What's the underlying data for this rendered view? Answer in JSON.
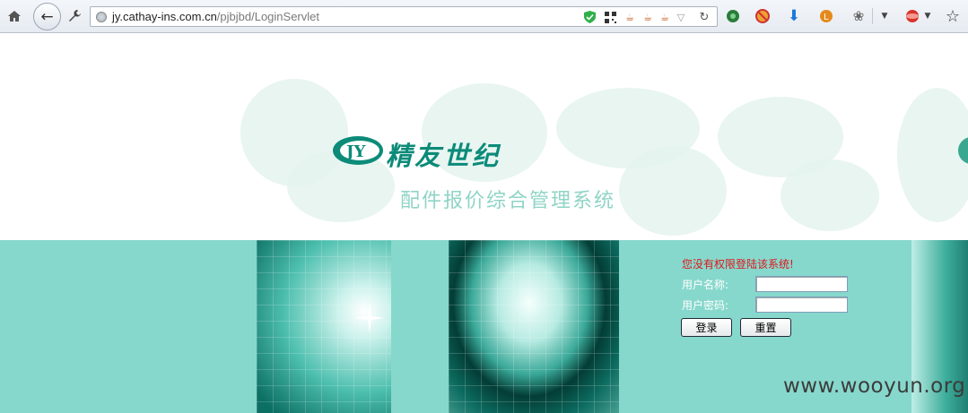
{
  "browser": {
    "url_host": "jy.cathay-ins.com.cn",
    "url_path": "/pjbjbd/LoginServlet"
  },
  "banner": {
    "logo_letters": "JY",
    "company_name": "精友世纪",
    "system_title": "配件报价综合管理系统"
  },
  "login": {
    "error_message": "您没有权限登陆该系统!",
    "username_label": "用户名称:",
    "password_label": "用户密码:",
    "username_value": "",
    "password_value": "",
    "login_button": "登录",
    "reset_button": "重置"
  },
  "watermark": "www.wooyun.org",
  "colors": {
    "brand_teal": "#0c8b79",
    "background_teal": "#87d8cc",
    "error_red": "#e0151a"
  }
}
